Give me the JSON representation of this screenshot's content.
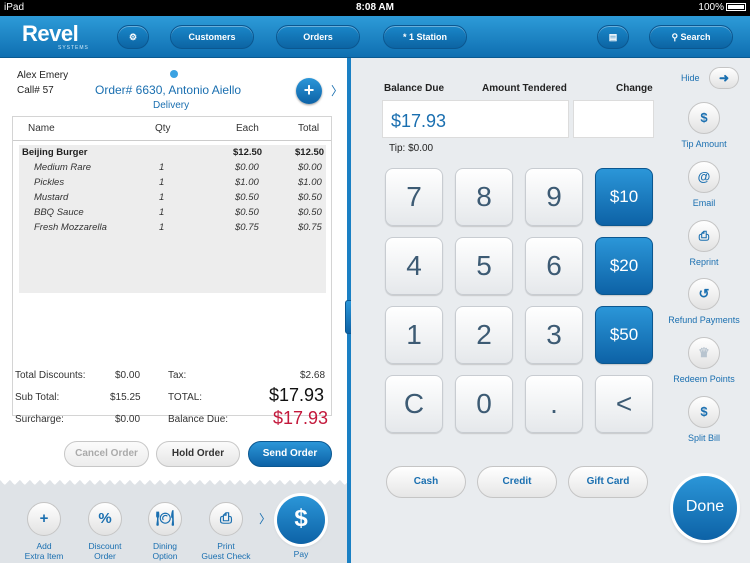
{
  "status_bar": {
    "device": "iPad",
    "time": "8:08 AM",
    "battery": "100%"
  },
  "nav": {
    "logo": "Revel",
    "logo_sub": "SYSTEMS",
    "customers": "Customers",
    "orders": "Orders",
    "station": "* 1 Station",
    "search": "Search"
  },
  "order": {
    "customer_name": "Alex Emery",
    "call": "Call# 57",
    "title": "Order# 6630, Antonio Aiello",
    "type": "Delivery",
    "columns": [
      "Name",
      "Qty",
      "Each",
      "Total"
    ],
    "items": [
      {
        "name": "Beijing Burger",
        "qty": "",
        "each": "$12.50",
        "total": "$12.50",
        "main": true
      },
      {
        "name": "Medium Rare",
        "qty": "1",
        "each": "$0.00",
        "total": "$0.00",
        "main": false
      },
      {
        "name": "Pickles",
        "qty": "1",
        "each": "$1.00",
        "total": "$1.00",
        "main": false
      },
      {
        "name": "Mustard",
        "qty": "1",
        "each": "$0.50",
        "total": "$0.50",
        "main": false
      },
      {
        "name": "BBQ Sauce",
        "qty": "1",
        "each": "$0.50",
        "total": "$0.50",
        "main": false
      },
      {
        "name": "Fresh Mozzarella",
        "qty": "1",
        "each": "$0.75",
        "total": "$0.75",
        "main": false
      }
    ],
    "totals": {
      "discounts_label": "Total Discounts:",
      "discounts": "$0.00",
      "subtotal_label": "Sub Total:",
      "subtotal": "$15.25",
      "surcharge_label": "Surcharge:",
      "surcharge": "$0.00",
      "tax_label": "Tax:",
      "tax": "$2.68",
      "total_label": "TOTAL:",
      "total": "$17.93",
      "balance_label": "Balance Due:",
      "balance": "$17.93"
    },
    "buttons": {
      "cancel": "Cancel Order",
      "hold": "Hold Order",
      "send": "Send Order"
    }
  },
  "actions": {
    "add_item": "Add\nExtra Item",
    "discount": "Discount\nOrder",
    "dining": "Dining\nOption",
    "print": "Print\nGuest Check",
    "pay": "Pay",
    "pay_symbol": "$"
  },
  "payment": {
    "balance_due_label": "Balance Due",
    "amount_tendered_label": "Amount Tendered",
    "change_label": "Change",
    "amount": "$17.93",
    "tip": "Tip: $0.00",
    "keys": [
      "7",
      "8",
      "9",
      "$10",
      "4",
      "5",
      "6",
      "$20",
      "1",
      "2",
      "3",
      "$50",
      "C",
      "0",
      ".",
      "<"
    ],
    "methods": {
      "cash": "Cash",
      "credit": "Credit",
      "gift_card": "Gift Card"
    },
    "done": "Done"
  },
  "sidebar": {
    "hide": "Hide",
    "items": [
      {
        "label": "Tip Amount",
        "icon": "cash-icon",
        "glyph": "$"
      },
      {
        "label": "Email",
        "icon": "email-icon",
        "glyph": "@"
      },
      {
        "label": "Reprint",
        "icon": "printer-icon",
        "glyph": "⎙"
      },
      {
        "label": "Refund Payments",
        "icon": "refund-icon",
        "glyph": "↺"
      },
      {
        "label": "Redeem Points",
        "icon": "trophy-icon",
        "glyph": "♛"
      },
      {
        "label": "Split Bill",
        "icon": "split-icon",
        "glyph": "$"
      }
    ]
  },
  "colors": {
    "accent": "#1a6fb0",
    "primary": "#0d62a6",
    "balance": "#c3183b"
  }
}
